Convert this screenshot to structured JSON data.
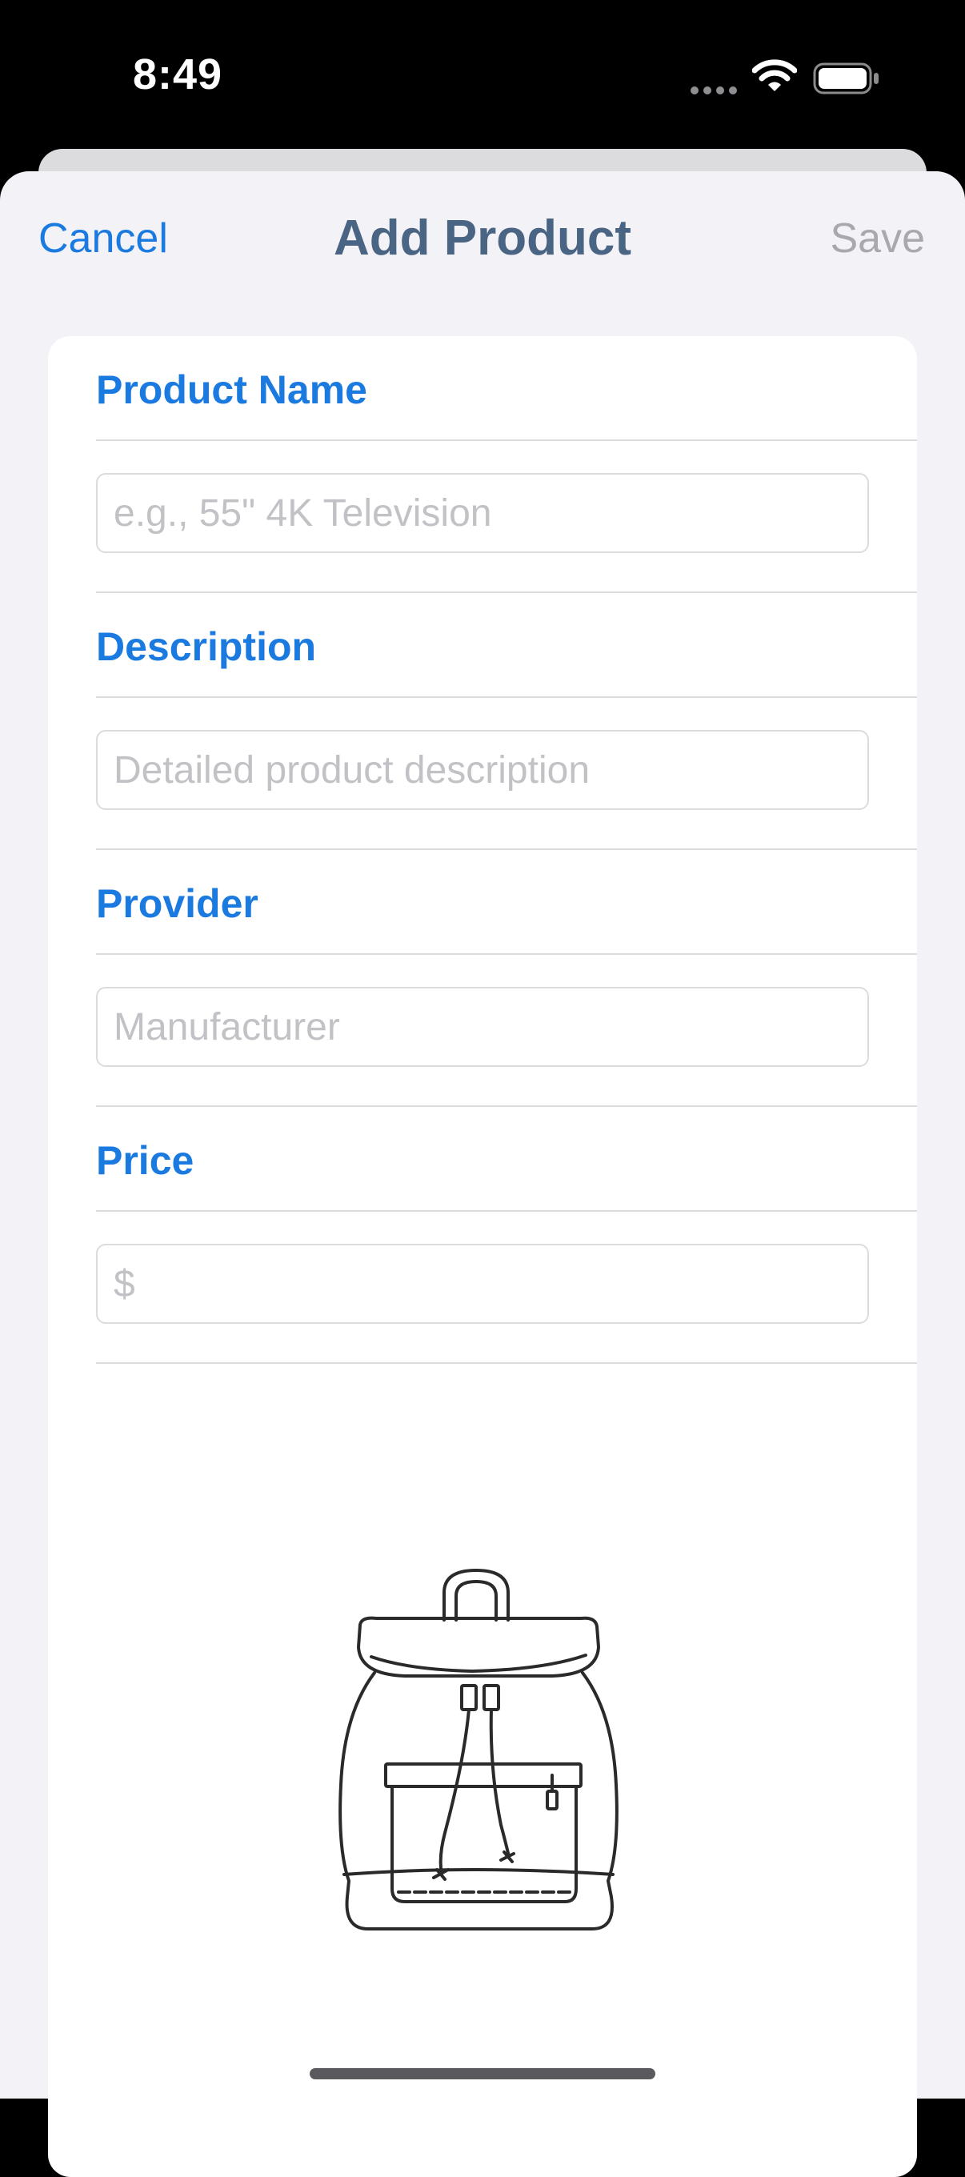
{
  "status_bar": {
    "time": "8:49",
    "icons": [
      "signal-dots-icon",
      "wifi-icon",
      "battery-icon"
    ]
  },
  "nav": {
    "cancel_label": "Cancel",
    "title": "Add Product",
    "save_label": "Save"
  },
  "form": {
    "product_name": {
      "label": "Product Name",
      "placeholder": "e.g., 55\" 4K Television",
      "value": ""
    },
    "description": {
      "label": "Description",
      "placeholder": "Detailed product description",
      "value": ""
    },
    "provider": {
      "label": "Provider",
      "placeholder": "Manufacturer",
      "value": ""
    },
    "price": {
      "label": "Price",
      "placeholder": "$",
      "value": ""
    }
  },
  "image": {
    "icon": "backpack-icon"
  },
  "colors": {
    "accent": "#1a7ae0",
    "title": "#4a6584",
    "disabled": "#a8a8ae",
    "placeholder": "#c2c2c6",
    "sheet_background": "#f2f2f7"
  }
}
